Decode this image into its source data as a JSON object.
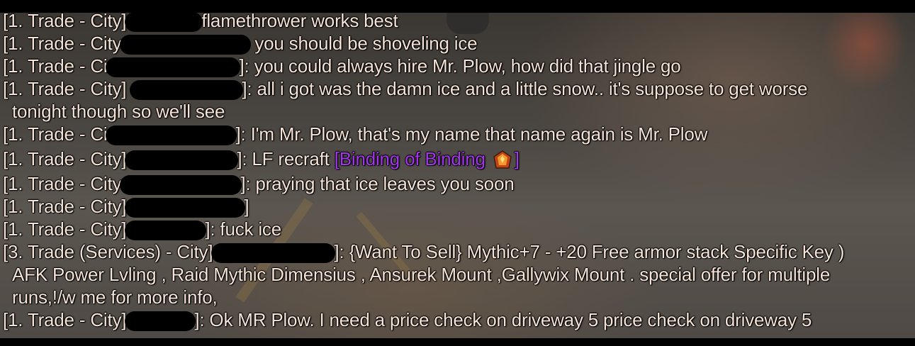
{
  "chat": {
    "lines": [
      {
        "channel": "[1. Trade - City]",
        "sep": "[",
        "message": "flamethrower works  best"
      },
      {
        "channel": "[1. Trade - City",
        "sep": "]:",
        "message": "you should be shoveling ice"
      },
      {
        "channel": "[1. Trade - Ci",
        "sep": "]:",
        "message": "you could always hire Mr. Plow, how did that jingle go"
      },
      {
        "channel": "[1. Trade - City]",
        "sep": "]:",
        "message": "all i got was the damn ice and a little snow.. it's suppose to get worse",
        "cont": "tonight though so we'll see"
      },
      {
        "channel": "[1. Trade - Ci",
        "sep": "]:",
        "message": "I'm Mr. Plow, that's my name that name again is Mr. Plow"
      },
      {
        "channel": "[1. Trade - City]",
        "sep": "]:",
        "message": "LF recraft",
        "link": "[Binding of Binding ",
        "link_end": "]"
      },
      {
        "channel": "[1. Trade - City",
        "sep": "]:",
        "message": "praying that ice leaves you soon"
      },
      {
        "channel": "[1. Trade - City]",
        "sep": "]",
        "message": ""
      },
      {
        "channel": "[1. Trade - City]",
        "sep": "]:",
        "message": "fuck ice"
      },
      {
        "channel": "[3. Trade (Services) - City]",
        "sep": "]:",
        "message": "{Want To Sell} Mythic+7 - +20 Free armor stack Specific Key )",
        "cont": "AFK Power Lvling , Raid  Mythic Dimensius , Ansurek Mount   ,Gallywix Mount    . special offer for multiple",
        "cont2": "runs,!/w me for more info,"
      },
      {
        "channel": "[1. Trade - City]",
        "sep": "]:",
        "message": "Ok MR Plow. I need a price check on driveway 5 price check on driveway 5"
      }
    ]
  },
  "colors": {
    "chat_text": "#f4e3d6",
    "item_link_epic": "#a335ee",
    "redaction": "#000000"
  },
  "icons": {
    "item": "gem-icon"
  }
}
